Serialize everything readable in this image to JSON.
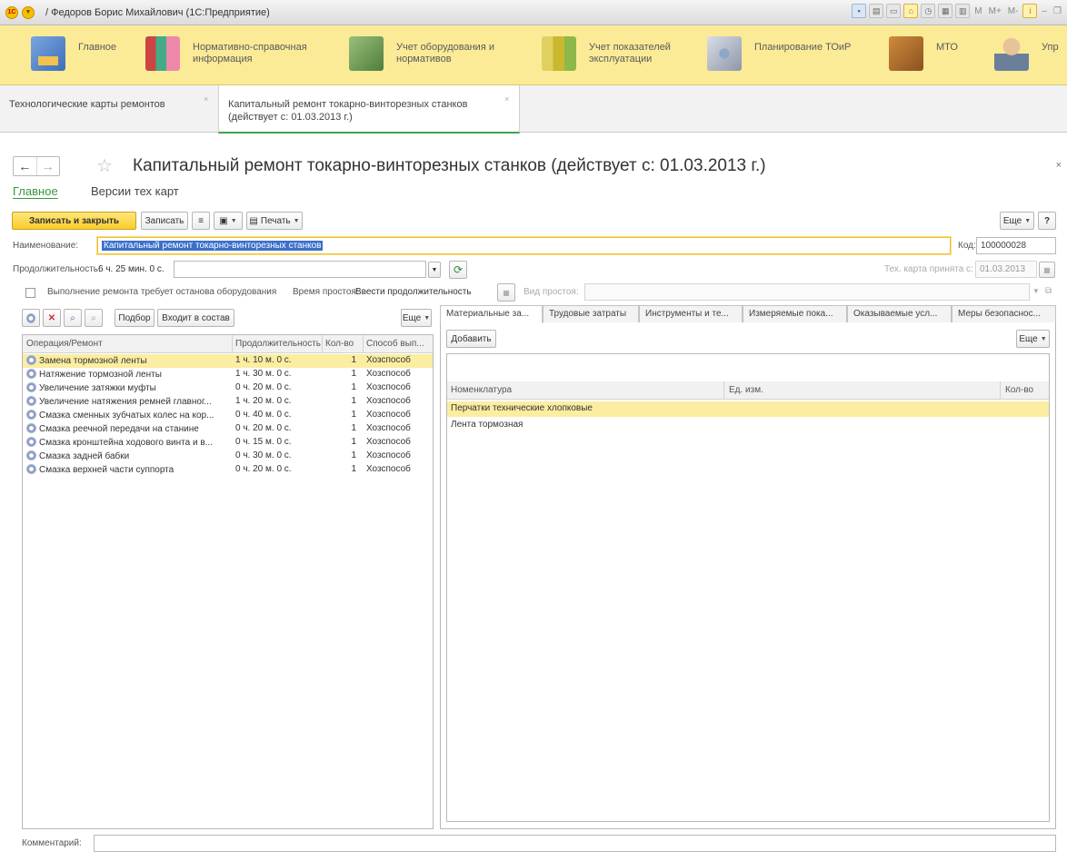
{
  "window": {
    "title": "/ Федоров Борис Михайлович (1С:Предприятие)"
  },
  "toolbar": {
    "m": "M",
    "mplus": "M+",
    "mminus": "M-"
  },
  "sections": [
    {
      "label": "Главное",
      "icon": "home-icon"
    },
    {
      "label": "Нормативно-справочная информация",
      "icon": "books-icon"
    },
    {
      "label": "Учет оборудования и нормативов",
      "icon": "machine-icon"
    },
    {
      "label": "Учет показателей эксплуатации",
      "icon": "chart-icon"
    },
    {
      "label": "Планирование ТОиР",
      "icon": "compass-icon"
    },
    {
      "label": "МТО",
      "icon": "boxes-icon"
    },
    {
      "label": "Упр",
      "icon": "person-icon"
    }
  ],
  "open_tabs": [
    {
      "label": "Технологические карты ремонтов",
      "close": "×"
    },
    {
      "label": "Капитальный ремонт токарно-винторезных станков (действует с: 01.03.2013 г.)",
      "close": "×"
    }
  ],
  "form": {
    "title": "Капитальный ремонт токарно-винторезных станков (действует с: 01.03.2013 г.)",
    "close": "×",
    "tabs": [
      "Главное",
      "Версии тех карт"
    ]
  },
  "commands": {
    "save_close": "Записать и закрыть",
    "save": "Записать",
    "print": "Печать",
    "more": "Еще",
    "help": "?"
  },
  "fields": {
    "name_label": "Наименование:",
    "name_value": "Капитальный ремонт токарно-винторезных станков",
    "code_label": "Код:",
    "code_value": "100000028",
    "duration_label": "Продолжительность:",
    "duration_value": "6 ч. 25 мин. 0 с.",
    "accepted_label": "Тех. карта принята с:",
    "accepted_value": "01.03.2013",
    "stop_label": "Выполнение ремонта требует останова оборудования",
    "downtime_label": "Время простоя:",
    "downtime_value": "Ввести продолжительность",
    "downtime_type_label": "Вид простоя:"
  },
  "left_panel": {
    "buttons": {
      "pick": "Подбор",
      "part_of": "Входит в состав",
      "more": "Еще"
    },
    "columns": [
      "Операция/Ремонт",
      "Продолжительность",
      "Кол-во",
      "Способ вып..."
    ],
    "rows": [
      {
        "op": "Замена тормозной ленты",
        "dur": "1 ч. 10 м. 0 с.",
        "qty": "1",
        "method": "Хозспособ"
      },
      {
        "op": "Натяжение тормозной ленты",
        "dur": "1 ч. 30 м. 0 с.",
        "qty": "1",
        "method": "Хозспособ"
      },
      {
        "op": "Увеличение затяжки муфты",
        "dur": "0 ч. 20 м. 0 с.",
        "qty": "1",
        "method": "Хозспособ"
      },
      {
        "op": "Увеличение натяжения ремней главног...",
        "dur": "1 ч. 20 м. 0 с.",
        "qty": "1",
        "method": "Хозспособ"
      },
      {
        "op": "Смазка сменных зубчатых колес на кор...",
        "dur": "0 ч. 40 м. 0 с.",
        "qty": "1",
        "method": "Хозспособ"
      },
      {
        "op": "Смазка реечной передачи на станине",
        "dur": "0 ч. 20 м. 0 с.",
        "qty": "1",
        "method": "Хозспособ"
      },
      {
        "op": "Смазка кронштейна ходового винта и в...",
        "dur": "0 ч. 15 м. 0 с.",
        "qty": "1",
        "method": "Хозспособ"
      },
      {
        "op": "Смазка задней бабки",
        "dur": "0 ч. 30 м. 0 с.",
        "qty": "1",
        "method": "Хозспособ"
      },
      {
        "op": "Смазка верхней части суппорта",
        "dur": "0 ч. 20 м. 0 с.",
        "qty": "1",
        "method": "Хозспособ"
      }
    ]
  },
  "right_panel": {
    "tabs": [
      "Материальные за...",
      "Трудовые затраты",
      "Инструменты и те...",
      "Измеряемые пока...",
      "Оказываемые усл...",
      "Меры безопаснос..."
    ],
    "add": "Добавить",
    "more": "Еще",
    "columns": [
      "Номенклатура",
      "Ед. изм.",
      "Кол-во"
    ],
    "rows": [
      {
        "name": "Перчатки технические хлопковые",
        "unit": "",
        "qty": ""
      },
      {
        "name": "Лента тормозная",
        "unit": "",
        "qty": ""
      }
    ]
  },
  "comment": {
    "label": "Комментарий:",
    "value": ""
  }
}
